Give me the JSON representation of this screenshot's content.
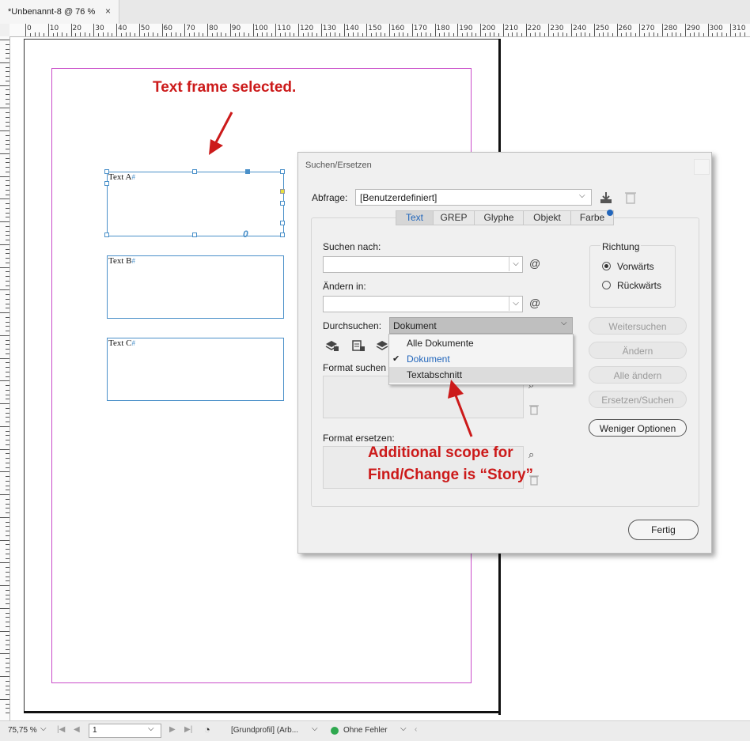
{
  "document_tab": {
    "title": "*Unbenannt-8 @ 76 %",
    "close_glyph": "×"
  },
  "ruler": {
    "h_labels": [
      "0",
      "10",
      "20",
      "30",
      "40",
      "50",
      "60",
      "70",
      "80",
      "90",
      "100",
      "110",
      "120",
      "130",
      "140",
      "150",
      "160",
      "170",
      "180",
      "190",
      "200",
      "210",
      "220",
      "230",
      "240",
      "250",
      "260",
      "270",
      "280",
      "290",
      "300",
      "310"
    ]
  },
  "frames": [
    {
      "label": "Text A",
      "selected": true
    },
    {
      "label": "Text B",
      "selected": false
    },
    {
      "label": "Text C",
      "selected": false
    }
  ],
  "frame_marker": "#",
  "overflow_glyph": "0",
  "annotations": {
    "top": "Text frame selected.",
    "bottom_line1": "Additional scope for",
    "bottom_line2": "Find/Change is “Story”"
  },
  "dialog": {
    "title": "Suchen/Ersetzen",
    "query_label": "Abfrage:",
    "query_value": "[Benutzerdefiniert]",
    "tabs": [
      "Text",
      "GREP",
      "Glyphe",
      "Objekt",
      "Farbe"
    ],
    "active_tab": "Text",
    "find_label": "Suchen nach:",
    "change_label": "Ändern in:",
    "search_label": "Durchsuchen:",
    "search_value": "Dokument",
    "format_find_label": "Format suchen",
    "format_change_label": "Format ersetzen:",
    "direction_title": "Richtung",
    "direction_options": [
      "Vorwärts",
      "Rückwärts"
    ],
    "direction_selected": "Vorwärts",
    "buttons": {
      "find_next": "Weitersuchen",
      "change": "Ändern",
      "change_all": "Alle ändern",
      "change_find": "Ersetzen/Suchen",
      "fewer_options": "Weniger Optionen",
      "done": "Fertig"
    },
    "at_symbol": "@",
    "dropdown_options": [
      "Alle Dokumente",
      "Dokument",
      "Textabschnitt"
    ],
    "dropdown_checked": "Dokument",
    "dropdown_hover": "Textabschnitt"
  },
  "status": {
    "zoom": "75,75 %",
    "page": "1",
    "profile": "[Grundprofil] (Arb...",
    "errors": "Ohne Fehler"
  },
  "colors": {
    "accent": "#2266bb",
    "annotation": "#cc1a1a",
    "margin": "#c94cc9",
    "frame": "#4a90c9",
    "ok": "#2fa84f"
  }
}
